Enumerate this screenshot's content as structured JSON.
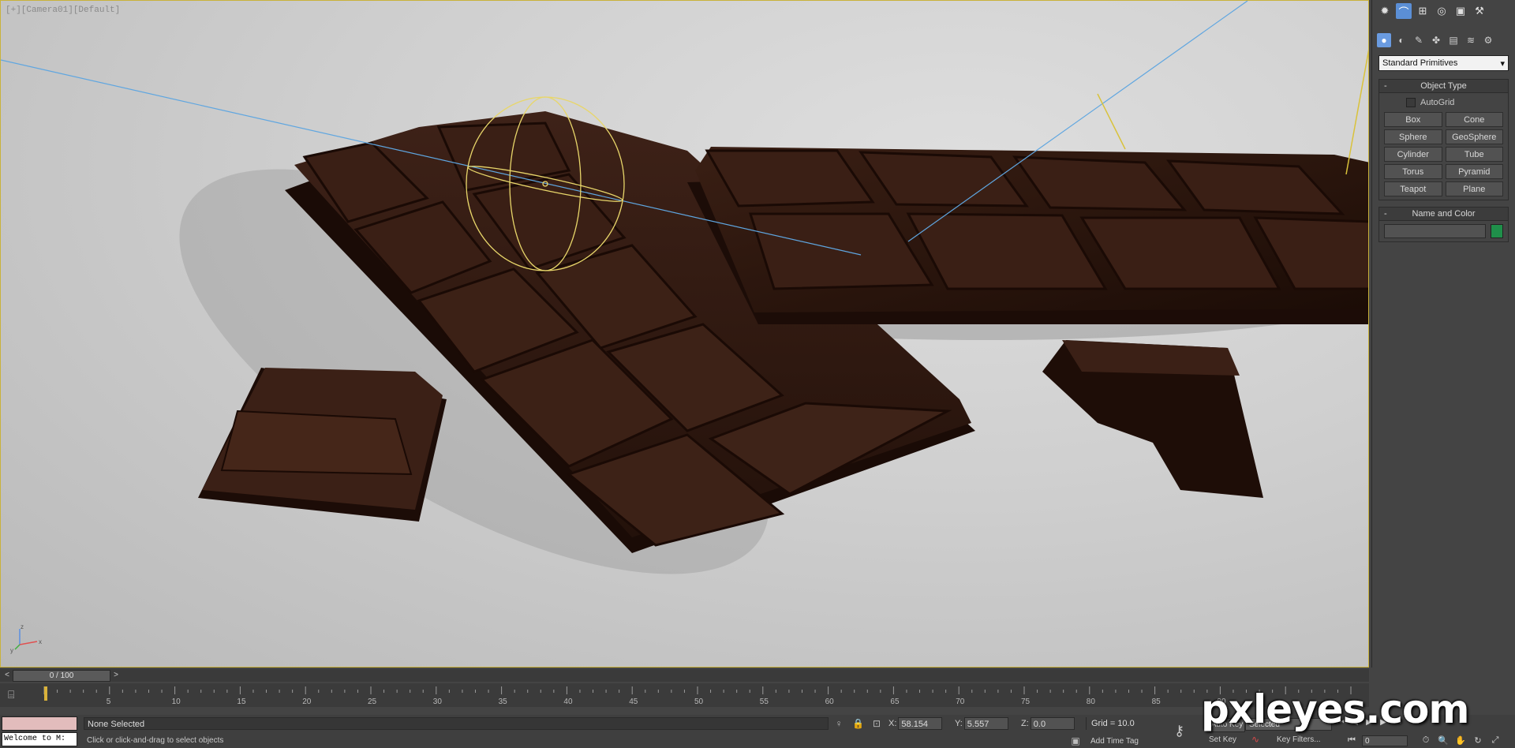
{
  "viewport": {
    "label": "[+][Camera01][Default]",
    "axis_labels": {
      "x": "x",
      "y": "y",
      "z": "z"
    }
  },
  "command_panel": {
    "top_tabs": [
      "create-icon",
      "modify-icon",
      "hierarchy-icon",
      "motion-icon",
      "display-icon",
      "utilities-icon"
    ],
    "sub_tabs": [
      "geometry-icon",
      "shapes-icon",
      "lights-icon",
      "cameras-icon",
      "helpers-icon",
      "spacewarps-icon",
      "systems-icon"
    ],
    "category_dropdown": "Standard Primitives",
    "object_type": {
      "title": "Object Type",
      "autogrid_label": "AutoGrid",
      "buttons": [
        "Box",
        "Cone",
        "Sphere",
        "GeoSphere",
        "Cylinder",
        "Tube",
        "Torus",
        "Pyramid",
        "Teapot",
        "Plane"
      ]
    },
    "name_and_color": {
      "title": "Name and Color",
      "name_value": "",
      "color": "#1f8f4a"
    }
  },
  "time_slider": {
    "frame_display": "0 / 100",
    "prev": "<",
    "next": ">"
  },
  "trackbar": {
    "ticks": [
      "5",
      "10",
      "15",
      "20",
      "25",
      "30",
      "35",
      "40",
      "45",
      "50",
      "55",
      "60",
      "65",
      "70",
      "75",
      "80",
      "85",
      "90"
    ]
  },
  "status": {
    "maxscript_text": "Welcome to M:",
    "selection": "None Selected",
    "prompt": "Click or click-and-drag to select objects",
    "x_label": "X:",
    "x_value": "58.154",
    "y_label": "Y:",
    "y_value": "5.557",
    "z_label": "Z:",
    "z_value": "0.0",
    "grid": "Grid = 10.0",
    "add_time_tag": "Add Time Tag",
    "auto_key": "Auto Key",
    "key_mode": "Selected",
    "set_key": "Set Key",
    "key_filters": "Key Filters...",
    "frame": "0"
  },
  "watermark": "pxleyes.com"
}
